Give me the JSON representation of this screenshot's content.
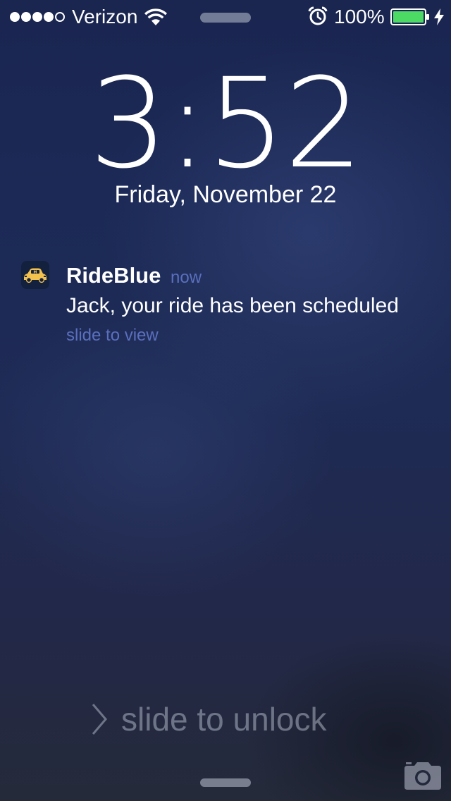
{
  "status_bar": {
    "signal_strength": "4 of 5",
    "carrier": "Verizon",
    "wifi_icon": "wifi-icon",
    "alarm_icon": "alarm-clock-icon",
    "battery_percent": "100%",
    "battery_level": 1.0,
    "battery_color": "#4cd964",
    "charging_icon": "lightning-bolt-icon"
  },
  "lock_screen": {
    "time": "3:52",
    "date": "Friday, November 22"
  },
  "notification": {
    "app_icon": "taxi-car-icon",
    "app_name": "RideBlue",
    "time": "now",
    "message": "Jack, your ride has been scheduled",
    "action": "slide to view",
    "accent_color": "#5a6fbe"
  },
  "unlock": {
    "chevron_icon": "chevron-right-icon",
    "label": "slide to unlock"
  },
  "camera": {
    "icon": "camera-icon"
  }
}
